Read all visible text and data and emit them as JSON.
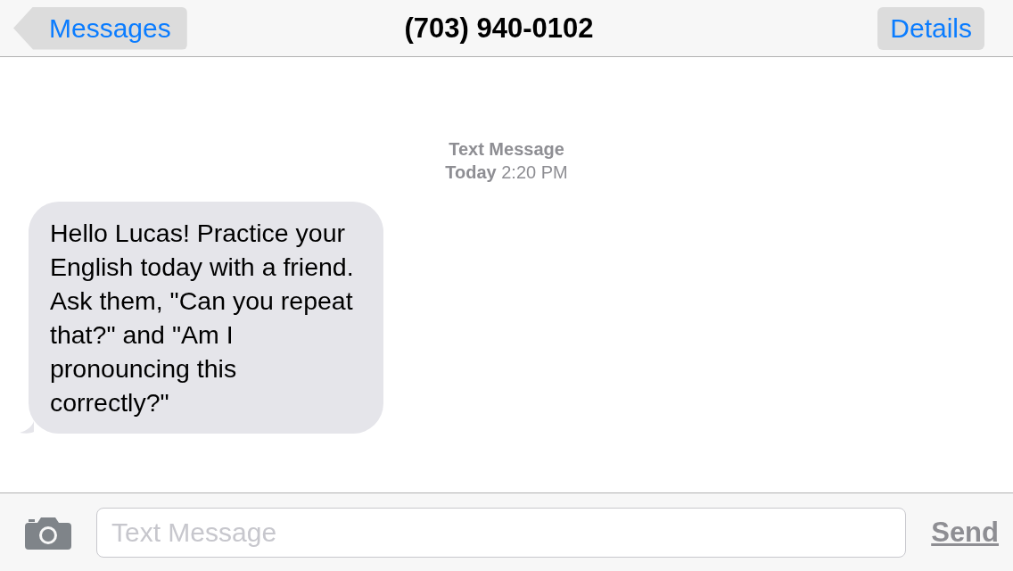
{
  "nav": {
    "back_label": "Messages",
    "title": "(703) 940-0102",
    "details_label": "Details"
  },
  "timestamp": {
    "label": "Text Message",
    "time": "**Today** 2:20 PM"
  },
  "messages": [
    {
      "kind": "incoming",
      "text": "Hello Lucas! Practice your English today with a friend. Ask them, \"Can you repeat that?\" and \"Am I pronouncing this correctly?\""
    }
  ],
  "composer": {
    "placeholder": "Text Message",
    "send": {
      "label": "Send",
      "disabled": true
    }
  }
}
